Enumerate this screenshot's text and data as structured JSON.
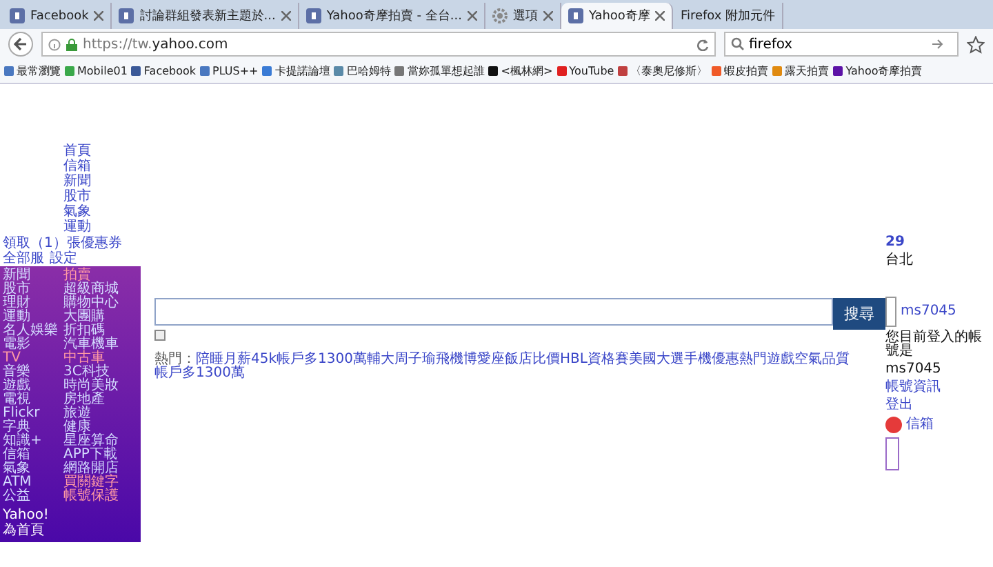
{
  "tabs": [
    {
      "title": "Facebook",
      "kind": "site",
      "selected": false
    },
    {
      "title": "討論群組發表新主題於...",
      "kind": "site",
      "selected": false
    },
    {
      "title": "Yahoo奇摩拍賣 - 全台...",
      "kind": "site",
      "selected": false
    },
    {
      "title": "選項",
      "kind": "settings",
      "selected": false
    },
    {
      "title": "Yahoo奇摩",
      "kind": "site",
      "selected": true
    },
    {
      "title": "Firefox 附加元件",
      "kind": "plain",
      "selected": false
    }
  ],
  "address": {
    "url_prefix": "https://tw.",
    "url_domain": "yahoo.com"
  },
  "search_field": {
    "value": "firefox"
  },
  "bookmarks": [
    {
      "label": "最常瀏覽",
      "color": "#4a78c0"
    },
    {
      "label": "Mobile01",
      "color": "#3aa84a"
    },
    {
      "label": "Facebook",
      "color": "#3b5998"
    },
    {
      "label": "PLUS++",
      "color": "#4a78c0"
    },
    {
      "label": "卡提諾論壇",
      "color": "#3a7bd5"
    },
    {
      "label": "巴哈姆特",
      "color": "#5a8aa8"
    },
    {
      "label": "當妳孤單想起誰",
      "color": "#777777"
    },
    {
      "label": "<楓林網>",
      "color": "#111111"
    },
    {
      "label": "YouTube",
      "color": "#e02020"
    },
    {
      "label": "〈泰奧尼修斯〉",
      "color": "#c04040"
    },
    {
      "label": "蝦皮拍賣",
      "color": "#f05a28"
    },
    {
      "label": "露天拍賣",
      "color": "#e08a10"
    },
    {
      "label": "Yahoo奇摩拍賣",
      "color": "#5c12a6"
    }
  ],
  "top_nav": [
    "首頁",
    "信箱",
    "新聞",
    "股市",
    "氣象",
    "運動"
  ],
  "coupon": "領取（1）張優惠券",
  "services": [
    [
      {
        "label": "新聞",
        "hot": false
      },
      {
        "label": "拍賣",
        "hot": true
      }
    ],
    [
      {
        "label": "股市",
        "hot": false
      },
      {
        "label": "超級商城",
        "hot": false
      }
    ],
    [
      {
        "label": "理財",
        "hot": false
      },
      {
        "label": "購物中心",
        "hot": false
      }
    ],
    [
      {
        "label": "運動",
        "hot": false
      },
      {
        "label": "大團購",
        "hot": false
      }
    ],
    [
      {
        "label": "名人娛樂",
        "hot": false
      },
      {
        "label": "折扣碼",
        "hot": false
      }
    ],
    [
      {
        "label": "電影",
        "hot": false
      },
      {
        "label": "汽車機車",
        "hot": false
      }
    ],
    [
      {
        "label": "TV",
        "hot": true
      },
      {
        "label": "中古車",
        "hot": true
      }
    ],
    [
      {
        "label": "音樂",
        "hot": false
      },
      {
        "label": "3C科技",
        "hot": false
      }
    ],
    [
      {
        "label": "遊戲",
        "hot": false
      },
      {
        "label": "時尚美妝",
        "hot": false
      }
    ],
    [
      {
        "label": "電視",
        "hot": false
      },
      {
        "label": "房地產",
        "hot": false
      }
    ],
    [
      {
        "label": "Flickr",
        "hot": false
      },
      {
        "label": "旅遊",
        "hot": false
      }
    ],
    [
      {
        "label": "字典",
        "hot": false
      },
      {
        "label": "健康",
        "hot": false
      }
    ],
    [
      {
        "label": "知識+",
        "hot": false
      },
      {
        "label": "星座算命",
        "hot": false
      }
    ],
    [
      {
        "label": "信箱",
        "hot": false
      },
      {
        "label": "APP下載",
        "hot": false
      }
    ],
    [
      {
        "label": "氣象",
        "hot": false
      },
      {
        "label": "網路開店",
        "hot": false
      }
    ],
    [
      {
        "label": "ATM",
        "hot": false
      },
      {
        "label": "買關鍵字",
        "hot": true
      }
    ],
    [
      {
        "label": "公益",
        "hot": false
      },
      {
        "label": "帳號保護",
        "hot": true
      }
    ]
  ],
  "homepage_link": [
    "Yahoo!",
    "為首頁"
  ],
  "all_services": "全部服",
  "settings": "設定",
  "search_button": "搜尋",
  "hot_label": "熱門：",
  "hot_terms": [
    "陪睡月薪45k",
    "帳戶多1300萬",
    "輔大周子瑜",
    "飛機博愛座",
    "飯店比價",
    "HBL資格賽",
    "美國大選",
    "手機優惠",
    "熱門遊戲",
    "空氣品質",
    "帳戶多1300萬"
  ],
  "weather": {
    "temp": "29",
    "city": "台北"
  },
  "account": {
    "user": "ms7045",
    "prompt": "您目前登入的帳號是",
    "user_again": "ms7045",
    "info": "帳號資訊",
    "logout": "登出",
    "mail": "信箱"
  }
}
